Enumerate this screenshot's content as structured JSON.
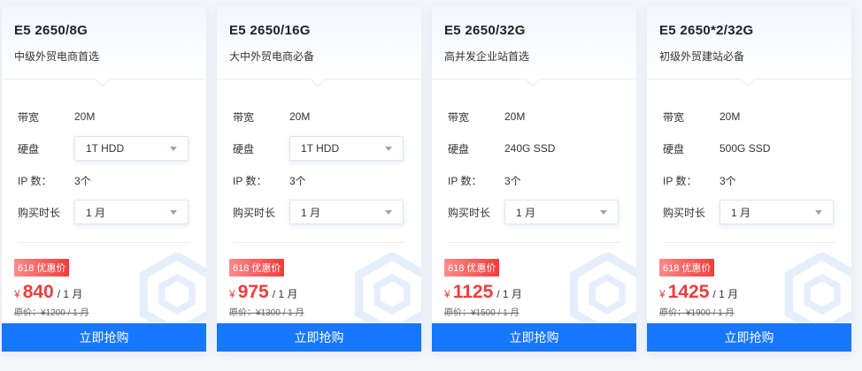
{
  "ui": {
    "bandwidth_label": "带宽",
    "disk_label": "硬盘",
    "ip_label": "IP 数：",
    "duration_label": "购买时长",
    "badge": "618 优惠价",
    "currency": "¥",
    "unit": "/ 1 月",
    "buy_label": "立即抢购",
    "accent_color": "#1677ff",
    "price_color": "#f23c3c"
  },
  "cards": [
    {
      "title": "E5 2650/8G",
      "subtitle": "中级外贸电商首选",
      "bandwidth": "20M",
      "disk": "1T HDD",
      "ip": "3个",
      "duration": "1 月",
      "price": "840",
      "original": "原价：¥1200 / 1 月"
    },
    {
      "title": "E5 2650/16G",
      "subtitle": "大中外贸电商必备",
      "bandwidth": "20M",
      "disk": "1T HDD",
      "ip": "3个",
      "duration": "1 月",
      "price": "975",
      "original": "原价：¥1300 / 1 月"
    },
    {
      "title": "E5 2650/32G",
      "subtitle": "高并发企业站首选",
      "bandwidth": "20M",
      "disk": "240G SSD",
      "ip": "3个",
      "duration": "1 月",
      "price": "1125",
      "original": "原价：¥1500 / 1 月"
    },
    {
      "title": "E5 2650*2/32G",
      "subtitle": "初级外贸建站必备",
      "bandwidth": "20M",
      "disk": "500G SSD",
      "ip": "3个",
      "duration": "1 月",
      "price": "1425",
      "original": "原价：¥1900 / 1 月"
    }
  ]
}
